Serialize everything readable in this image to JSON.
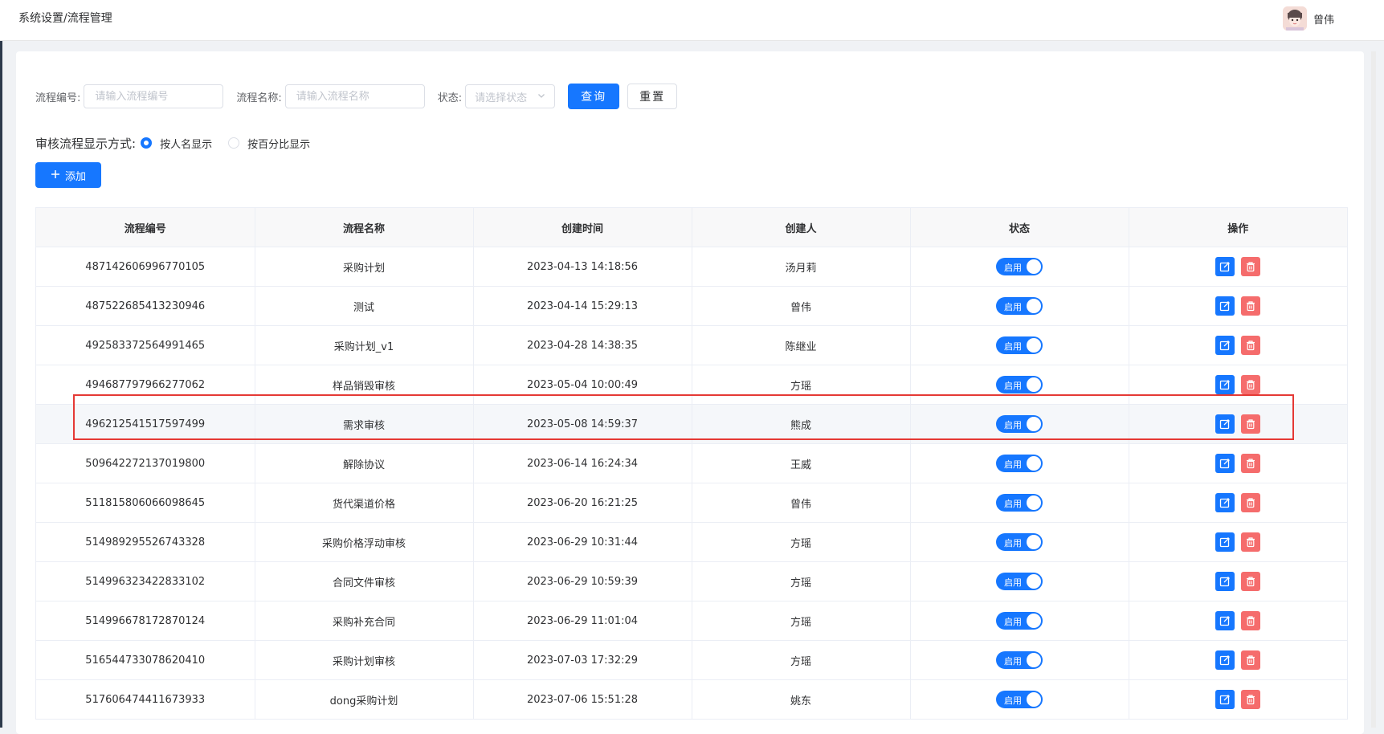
{
  "header": {
    "breadcrumb": "系统设置/流程管理",
    "user_name": "曾伟"
  },
  "filters": {
    "code_label": "流程编号:",
    "code_placeholder": "请输入流程编号",
    "name_label": "流程名称:",
    "name_placeholder": "请输入流程名称",
    "status_label": "状态:",
    "status_placeholder": "请选择状态",
    "query_label": "查询",
    "reset_label": "重置"
  },
  "display_mode": {
    "title": "审核流程显示方式:",
    "options": [
      {
        "label": "按人名显示",
        "checked": true
      },
      {
        "label": "按百分比显示",
        "checked": false
      }
    ]
  },
  "add_label": "添加",
  "table": {
    "columns": [
      "流程编号",
      "流程名称",
      "创建时间",
      "创建人",
      "状态",
      "操作"
    ],
    "rows": [
      {
        "code": "487142606996770105",
        "name": "采购计划",
        "created": "2023-04-13 14:18:56",
        "creator": "汤月莉",
        "status": "启用"
      },
      {
        "code": "487522685413230946",
        "name": "测试",
        "created": "2023-04-14 15:29:13",
        "creator": "曾伟",
        "status": "启用"
      },
      {
        "code": "492583372564991465",
        "name": "采购计划_v1",
        "created": "2023-04-28 14:38:35",
        "creator": "陈继业",
        "status": "启用"
      },
      {
        "code": "494687797966277062",
        "name": "样品销毁审核",
        "created": "2023-05-04 10:00:49",
        "creator": "方瑶",
        "status": "启用"
      },
      {
        "code": "496212541517597499",
        "name": "需求审核",
        "created": "2023-05-08 14:59:37",
        "creator": "熊成",
        "status": "启用"
      },
      {
        "code": "509642272137019800",
        "name": "解除协议",
        "created": "2023-06-14 16:24:34",
        "creator": "王威",
        "status": "启用"
      },
      {
        "code": "511815806066098645",
        "name": "货代渠道价格",
        "created": "2023-06-20 16:21:25",
        "creator": "曾伟",
        "status": "启用"
      },
      {
        "code": "514989295526743328",
        "name": "采购价格浮动审核",
        "created": "2023-06-29 10:31:44",
        "creator": "方瑶",
        "status": "启用"
      },
      {
        "code": "514996323422833102",
        "name": "合同文件审核",
        "created": "2023-06-29 10:59:39",
        "creator": "方瑶",
        "status": "启用"
      },
      {
        "code": "514996678172870124",
        "name": "采购补充合同",
        "created": "2023-06-29 11:01:04",
        "creator": "方瑶",
        "status": "启用"
      },
      {
        "code": "516544733078620410",
        "name": "采购计划审核",
        "created": "2023-07-03 17:32:29",
        "creator": "方瑶",
        "status": "启用"
      },
      {
        "code": "517606474411673933",
        "name": "dong采购计划",
        "created": "2023-07-06 15:51:28",
        "creator": "姚东",
        "status": "启用"
      }
    ]
  },
  "colors": {
    "primary": "#1677ff",
    "danger": "#f56c6c",
    "highlight_border": "#e53935"
  },
  "icons": {
    "edit": "edit-icon",
    "delete": "trash-icon",
    "add": "plus-icon",
    "select": "chevron-down-icon"
  }
}
